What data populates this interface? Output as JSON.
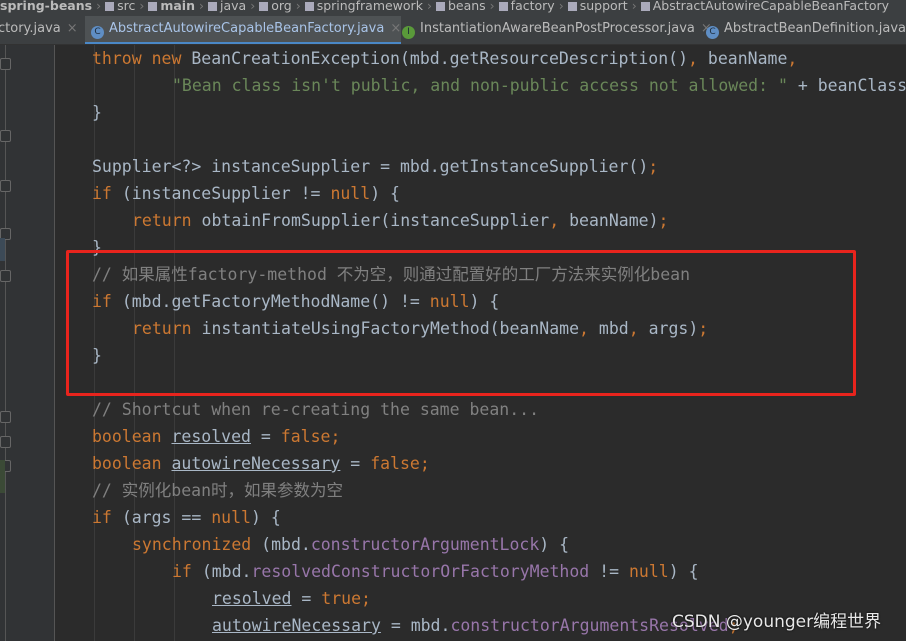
{
  "breadcrumb": [
    "spring-beans",
    "src",
    "main",
    "java",
    "org",
    "springframework",
    "beans",
    "factory",
    "support",
    "AbstractAutowireCapableBeanFactory"
  ],
  "tabs": [
    {
      "label": "ctory.java",
      "icon": "class-icon",
      "active": false
    },
    {
      "label": "AbstractAutowireCapableBeanFactory.java",
      "icon": "class-icon",
      "active": true
    },
    {
      "label": "InstantiationAwareBeanPostProcessor.java",
      "icon": "interface-icon",
      "active": false
    },
    {
      "label": "AbstractBeanDefinition.java",
      "icon": "class-icon",
      "active": false
    }
  ],
  "tab_close": "×",
  "code": [
    [
      2,
      [
        [
          "kw",
          "throw new "
        ],
        [
          "",
          "BeanCreationException(mbd.getResourceDescription()"
        ],
        [
          "kw",
          ", "
        ],
        [
          "",
          "beanName"
        ],
        [
          "kw",
          ","
        ]
      ]
    ],
    [
      4,
      [
        [
          "str",
          "\"Bean class isn't public, and non-public access not allowed: \""
        ],
        [
          "",
          " + beanClass"
        ]
      ]
    ],
    [
      2,
      [
        [
          "",
          "}"
        ]
      ]
    ],
    [
      2,
      []
    ],
    [
      2,
      [
        [
          "",
          "Supplier<?> instanceSupplier = mbd.getInstanceSupplier()"
        ],
        [
          "kw",
          ";"
        ]
      ]
    ],
    [
      2,
      [
        [
          "kw",
          "if "
        ],
        [
          "",
          "(instanceSupplier != "
        ],
        [
          "kw",
          "null"
        ],
        [
          "",
          ") {"
        ]
      ]
    ],
    [
      3,
      [
        [
          "kw",
          "return "
        ],
        [
          "",
          "obtainFromSupplier(instanceSupplier"
        ],
        [
          "kw",
          ", "
        ],
        [
          "",
          "beanName)"
        ],
        [
          "kw",
          ";"
        ]
      ]
    ],
    [
      2,
      [
        [
          "",
          "}"
        ]
      ]
    ],
    [
      2,
      [
        [
          "cm",
          "// 如果属性factory-method 不为空，则通过配置好的工厂方法来实例化bean"
        ]
      ]
    ],
    [
      2,
      [
        [
          "kw",
          "if "
        ],
        [
          "",
          "(mbd.getFactoryMethodName() != "
        ],
        [
          "kw",
          "null"
        ],
        [
          "",
          ") {"
        ]
      ]
    ],
    [
      3,
      [
        [
          "kw",
          "return "
        ],
        [
          "",
          "instantiateUsingFactoryMethod(beanName"
        ],
        [
          "kw",
          ", "
        ],
        [
          "",
          "mbd"
        ],
        [
          "kw",
          ", "
        ],
        [
          "",
          "args)"
        ],
        [
          "kw",
          ";"
        ]
      ]
    ],
    [
      2,
      [
        [
          "",
          "}"
        ]
      ]
    ],
    [
      2,
      []
    ],
    [
      2,
      [
        [
          "cm",
          "// Shortcut when re-creating the same bean..."
        ]
      ]
    ],
    [
      2,
      [
        [
          "kw",
          "boolean "
        ],
        [
          "ul",
          "resolved"
        ],
        [
          "",
          " = "
        ],
        [
          "kw",
          "false;"
        ]
      ]
    ],
    [
      2,
      [
        [
          "kw",
          "boolean "
        ],
        [
          "ul",
          "autowireNecessary"
        ],
        [
          "",
          " = "
        ],
        [
          "kw",
          "false;"
        ]
      ]
    ],
    [
      2,
      [
        [
          "cm",
          "// 实例化bean时，如果参数为空"
        ]
      ]
    ],
    [
      2,
      [
        [
          "kw",
          "if "
        ],
        [
          "",
          "(args == "
        ],
        [
          "kw",
          "null"
        ],
        [
          "",
          ") {"
        ]
      ]
    ],
    [
      3,
      [
        [
          "kw",
          "synchronized "
        ],
        [
          "",
          "(mbd."
        ],
        [
          "fd",
          "constructorArgumentLock"
        ],
        [
          "",
          ") {"
        ]
      ]
    ],
    [
      4,
      [
        [
          "kw",
          "if "
        ],
        [
          "",
          "(mbd."
        ],
        [
          "fd",
          "resolvedConstructorOrFactoryMethod"
        ],
        [
          "",
          " != "
        ],
        [
          "kw",
          "null"
        ],
        [
          "",
          ") {"
        ]
      ]
    ],
    [
      5,
      [
        [
          "ul",
          "resolved"
        ],
        [
          "",
          " = "
        ],
        [
          "kw",
          "true;"
        ]
      ]
    ],
    [
      5,
      [
        [
          "ul",
          "autowireNecessary"
        ],
        [
          "",
          " = mbd."
        ],
        [
          "fd",
          "constructorArgumentsResolved"
        ],
        [
          "kw",
          ";"
        ]
      ]
    ]
  ],
  "watermark": "CSDN @younger编程世界",
  "colors": {
    "background": "#2b2b2b",
    "keyword": "#cc7832",
    "string": "#6a8759",
    "comment": "#808080",
    "field": "#9876aa",
    "highlight_box": "#e8241d"
  }
}
